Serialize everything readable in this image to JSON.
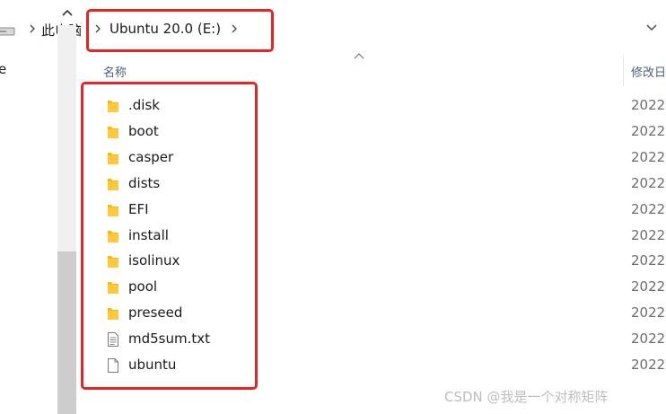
{
  "address_bar": {
    "crumbs": [
      "此电脑",
      "Ubuntu 20.0 (E:)"
    ],
    "drive_icon": "drive-icon",
    "chevron_icon": "chevron-down-icon"
  },
  "nav_pane": {
    "partial_label": "e"
  },
  "columns": {
    "name": "名称",
    "date": "修改日"
  },
  "files": [
    {
      "name": ".disk",
      "type": "folder",
      "date": "2022"
    },
    {
      "name": "boot",
      "type": "folder",
      "date": "2022"
    },
    {
      "name": "casper",
      "type": "folder",
      "date": "2022"
    },
    {
      "name": "dists",
      "type": "folder",
      "date": "2022"
    },
    {
      "name": "EFI",
      "type": "folder",
      "date": "2022"
    },
    {
      "name": "install",
      "type": "folder",
      "date": "2022"
    },
    {
      "name": "isolinux",
      "type": "folder",
      "date": "2022"
    },
    {
      "name": "pool",
      "type": "folder",
      "date": "2022"
    },
    {
      "name": "preseed",
      "type": "folder",
      "date": "2022"
    },
    {
      "name": "md5sum.txt",
      "type": "text-file",
      "date": "2022"
    },
    {
      "name": "ubuntu",
      "type": "file",
      "date": "2022"
    }
  ],
  "colors": {
    "folder": "#ffb900",
    "annotation": "#e52525",
    "header_text": "#4c607a"
  },
  "watermark": "CSDN @我是一个对称矩阵"
}
